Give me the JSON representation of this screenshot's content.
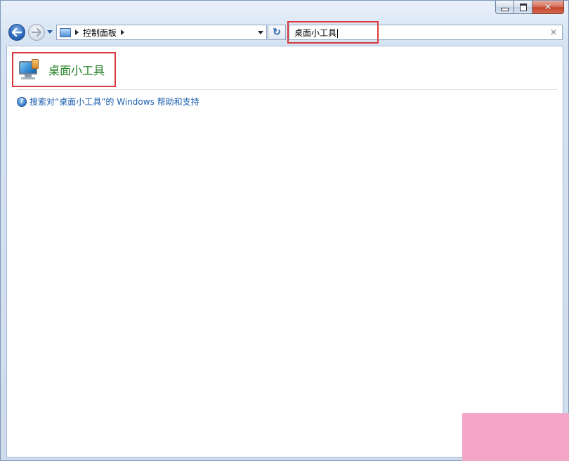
{
  "window": {
    "caption_buttons": {
      "minimize": "minimize",
      "maximize": "maximize",
      "close": "✕"
    }
  },
  "nav": {
    "breadcrumb": [
      "控制面板"
    ],
    "search": {
      "value": "桌面小工具"
    }
  },
  "results": [
    {
      "title": "桌面小工具",
      "icon": "desktop-gadgets-icon"
    }
  ],
  "help": {
    "text": "搜索对“桌面小工具”的 Windows 帮助和支持",
    "icon": "help-icon"
  },
  "colors": {
    "result_title": "#1e7d1e",
    "link": "#1a5cae",
    "highlight": "#d9393e",
    "pink_overlay": "#f4a6c9"
  }
}
